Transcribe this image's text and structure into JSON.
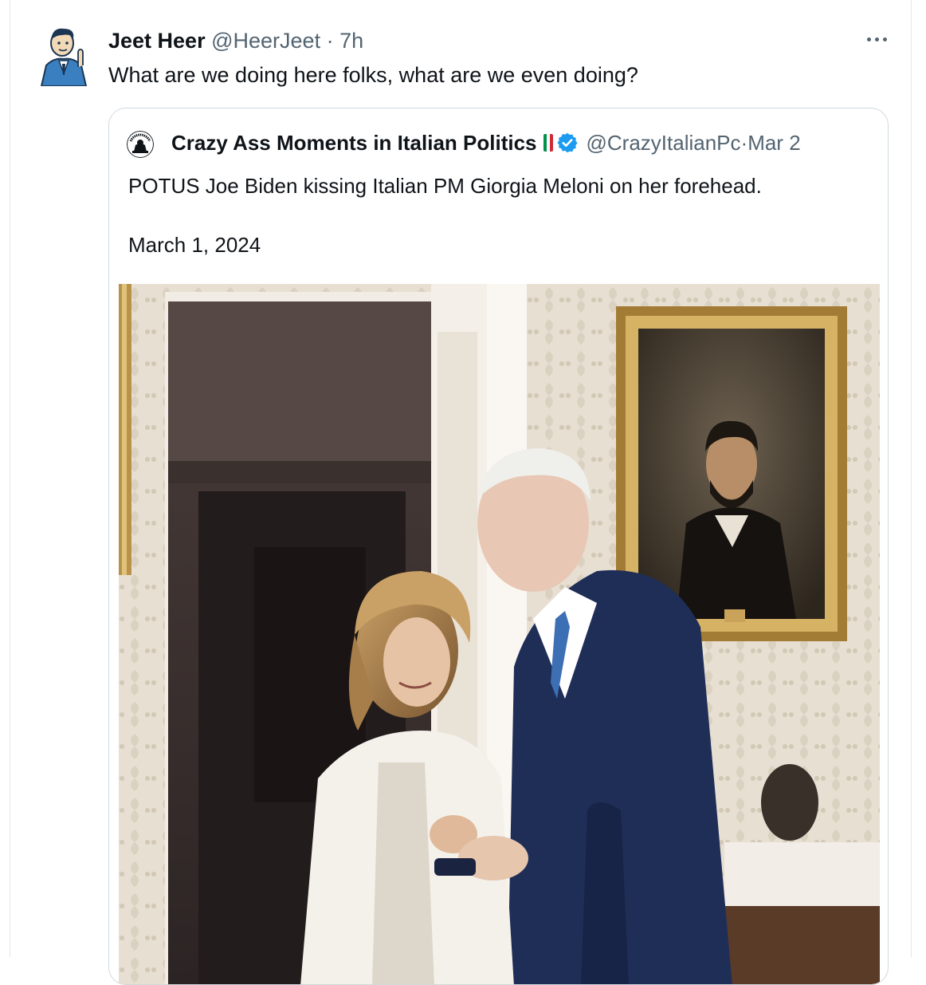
{
  "tweet": {
    "author_name": "Jeet Heer",
    "handle": "@HeerJeet",
    "separator": " · ",
    "time": "7h",
    "text": "What are we doing here folks, what are we even doing?"
  },
  "quote": {
    "author_name": "Crazy Ass Moments in Italian Politics",
    "handle": "@CrazyItalianPc",
    "separator": " · ",
    "date": "Mar 2",
    "text_line1": "POTUS Joe Biden kissing Italian PM Giorgia Meloni on her forehead.",
    "text_line2": "March 1, 2024",
    "avatar_caption": "CRAZY ASS MOMENTS IN ITALIAN POLITICS"
  },
  "icons": {
    "more": "more-horizontal-icon",
    "verified": "verified-badge-icon",
    "flag": "italy-flag-icon"
  },
  "colors": {
    "text": "#0f1419",
    "muted": "#536471",
    "verified": "#1d9bf0",
    "border": "#cfd9de",
    "flag_green": "#009246",
    "flag_white": "#ffffff",
    "flag_red": "#ce2b37"
  }
}
